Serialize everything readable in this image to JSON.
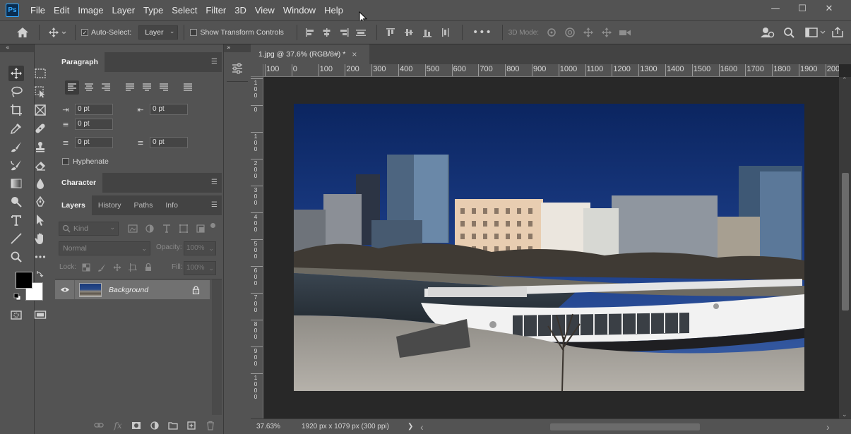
{
  "app": {
    "logo": "Ps"
  },
  "menu": [
    "File",
    "Edit",
    "Image",
    "Layer",
    "Type",
    "Select",
    "Filter",
    "3D",
    "View",
    "Window",
    "Help"
  ],
  "window_controls": {
    "minimize": "—",
    "maximize": "☐",
    "close": "✕"
  },
  "options_bar": {
    "auto_select_label": "Auto-Select:",
    "auto_select_checked": true,
    "auto_select_target": "Layer",
    "show_transform_label": "Show Transform Controls",
    "show_transform_checked": false,
    "mode_3d_label": "3D Mode:",
    "more_label": "•••"
  },
  "collapse_glyph": "«",
  "expand_glyph": "»",
  "paragraph_panel": {
    "tab": "Paragraph",
    "indent_left": "0 pt",
    "indent_right": "0 pt",
    "indent_first": "0 pt",
    "space_before": "0 pt",
    "space_after": "0 pt",
    "hyphenate_label": "Hyphenate",
    "hyphenate_checked": false
  },
  "character_panel": {
    "tab": "Character"
  },
  "layers_panel": {
    "tabs": [
      "Layers",
      "History",
      "Paths",
      "Info"
    ],
    "active_tab": "Layers",
    "filter_placeholder": "Kind",
    "blend_mode": "Normal",
    "opacity_label": "Opacity:",
    "opacity_value": "100%",
    "lock_label": "Lock:",
    "fill_label": "Fill:",
    "fill_value": "100%",
    "layers": [
      {
        "name": "Background",
        "visible": true,
        "locked": true
      }
    ]
  },
  "document": {
    "tab_title": "1.jpg @ 37.6% (RGB/8#) *",
    "close_glyph": "×",
    "zoom": "37.63%",
    "doc_info": "1920 px x 1079 px (300 ppi)",
    "status_arrow": "❯",
    "scroll_left": "‹",
    "scroll_right": "›",
    "scroll_down": "⌄"
  },
  "ruler_h_labels": [
    "100",
    "0",
    "100",
    "200",
    "300",
    "400",
    "500",
    "600",
    "700",
    "800",
    "900",
    "1000",
    "1100",
    "1200",
    "1300",
    "1400",
    "1500",
    "1600",
    "1700",
    "1800",
    "1900",
    "200"
  ],
  "ruler_v_labels": [
    "100",
    "0",
    "100",
    "200",
    "300",
    "400",
    "500",
    "600",
    "700",
    "800",
    "900",
    "1000"
  ],
  "colors": {
    "foreground": "#000000",
    "background": "#ffffff",
    "accent": "#31a8ff"
  }
}
